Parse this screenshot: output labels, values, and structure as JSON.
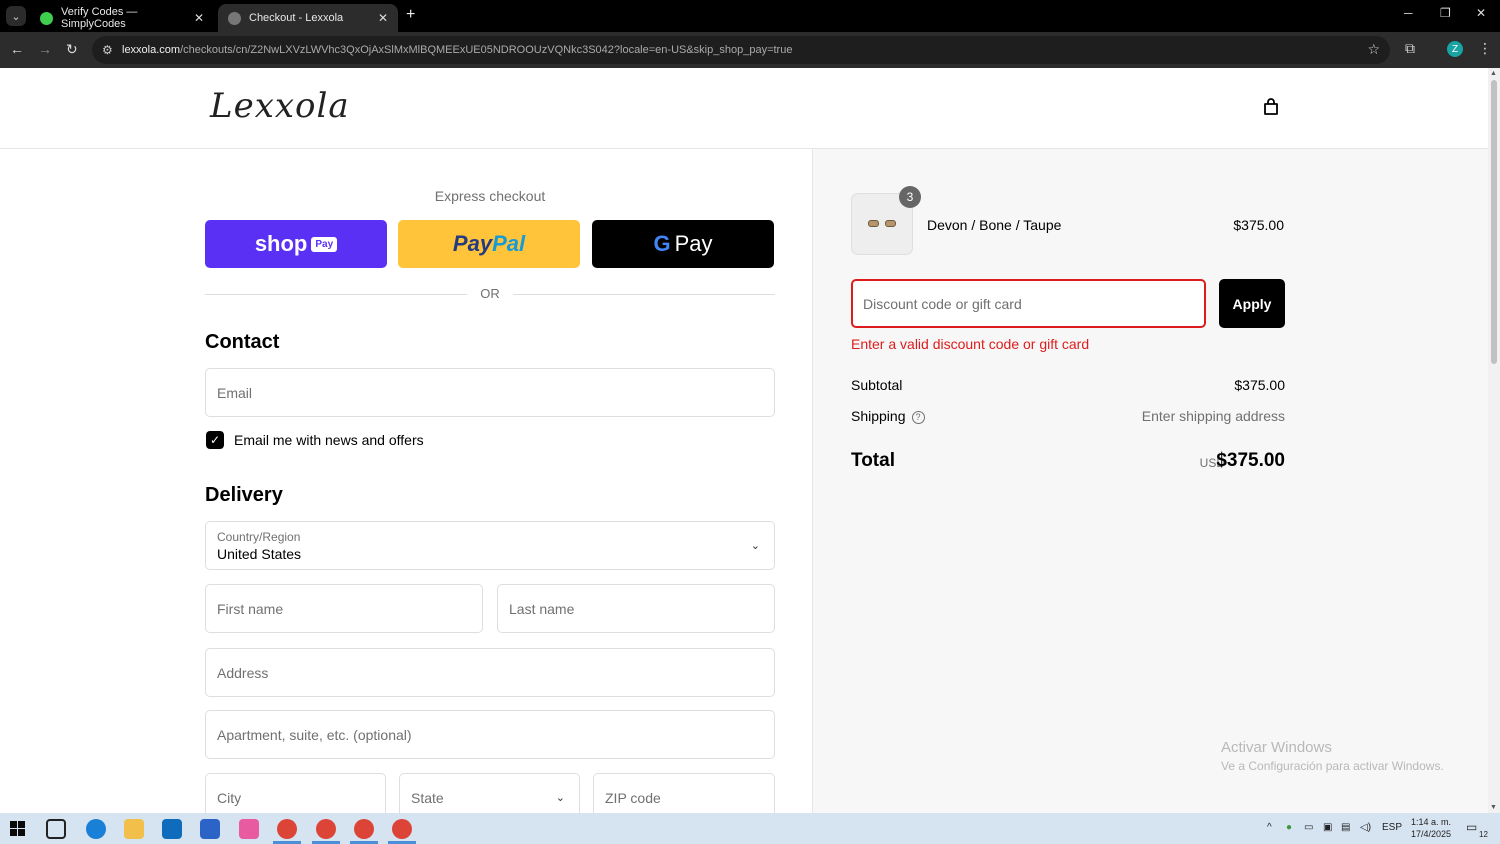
{
  "browser": {
    "tabs": [
      {
        "title": "Verify Codes — SimplyCodes",
        "active": false
      },
      {
        "title": "Checkout - Lexxola",
        "active": true
      }
    ],
    "url_host": "lexxola.com",
    "url_rest": "/checkouts/cn/Z2NwLXVzLWVhc3QxOjAxSlMxMlBQMEExUE05NDROOUzVQNkc3S042?locale=en-US&skip_shop_pay=true",
    "profile_initial": "Z"
  },
  "header": {
    "logo": "Lexxola"
  },
  "express": {
    "title": "Express checkout",
    "shop_label": "shop",
    "shop_tag": "Pay",
    "paypal_part1": "Pay",
    "paypal_part2": "Pal",
    "gpay_g": "G",
    "gpay_label": "Pay",
    "or": "OR"
  },
  "contact": {
    "title": "Contact",
    "email_placeholder": "Email",
    "newsletter_label": "Email me with news and offers",
    "newsletter_checked": true
  },
  "delivery": {
    "title": "Delivery",
    "country_label": "Country/Region",
    "country_value": "United States",
    "first_name": "First name",
    "last_name": "Last name",
    "address": "Address",
    "apartment": "Apartment, suite, etc. (optional)",
    "city": "City",
    "state": "State",
    "zip": "ZIP code"
  },
  "summary": {
    "item": {
      "name": "Devon / Bone / Taupe",
      "price": "$375.00",
      "quantity": "3"
    },
    "discount_placeholder": "Discount code or gift card",
    "apply_label": "Apply",
    "error": "Enter a valid discount code or gift card",
    "subtotal_label": "Subtotal",
    "subtotal_value": "$375.00",
    "shipping_label": "Shipping",
    "shipping_value": "Enter shipping address",
    "total_label": "Total",
    "currency": "USD",
    "total_value": "$375.00"
  },
  "watermark": {
    "line1": "Activar Windows",
    "line2": "Ve a Configuración para activar Windows."
  },
  "taskbar": {
    "lang": "ESP",
    "time": "1:14 a. m.",
    "date": "17/4/2025",
    "notifications": "12"
  },
  "colors": {
    "shop_pay": "#5a31f4",
    "paypal": "#ffc439",
    "error": "#dd1d1d"
  }
}
